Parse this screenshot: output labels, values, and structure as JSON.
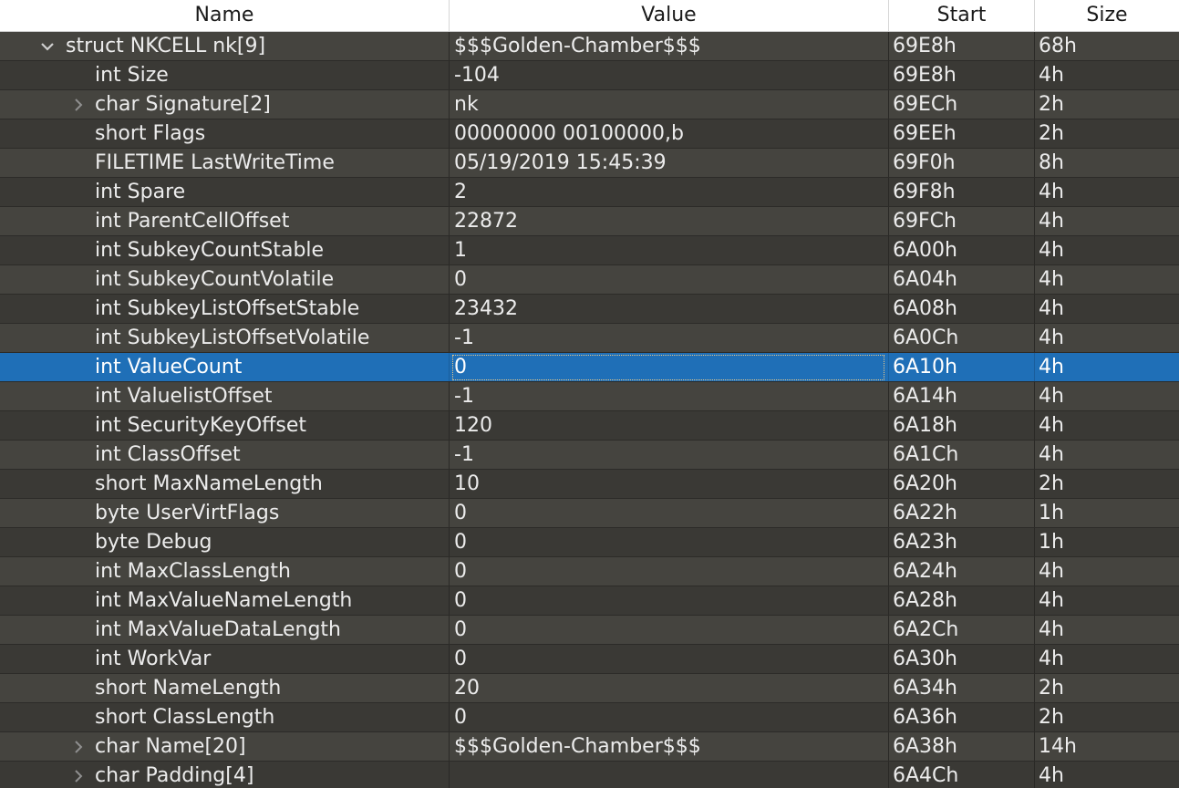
{
  "columns": {
    "name": "Name",
    "value": "Value",
    "start": "Start",
    "size": "Size"
  },
  "rows": [
    {
      "level": 0,
      "expander": "expanded",
      "name": "struct NKCELL nk[9]",
      "value": "$$$Golden-Chamber$$$",
      "start": "69E8h",
      "size": "68h"
    },
    {
      "level": 1,
      "expander": "none",
      "name": "int Size",
      "value": "-104",
      "start": "69E8h",
      "size": "4h"
    },
    {
      "level": 1,
      "expander": "collapsed",
      "name": "char Signature[2]",
      "value": "nk",
      "start": "69ECh",
      "size": "2h"
    },
    {
      "level": 1,
      "expander": "none",
      "name": "short Flags",
      "value": "00000000 00100000,b",
      "start": "69EEh",
      "size": "2h"
    },
    {
      "level": 1,
      "expander": "none",
      "name": "FILETIME LastWriteTime",
      "value": "05/19/2019 15:45:39",
      "start": "69F0h",
      "size": "8h"
    },
    {
      "level": 1,
      "expander": "none",
      "name": "int Spare",
      "value": "2",
      "start": "69F8h",
      "size": "4h"
    },
    {
      "level": 1,
      "expander": "none",
      "name": "int ParentCellOffset",
      "value": "22872",
      "start": "69FCh",
      "size": "4h"
    },
    {
      "level": 1,
      "expander": "none",
      "name": "int SubkeyCountStable",
      "value": "1",
      "start": "6A00h",
      "size": "4h"
    },
    {
      "level": 1,
      "expander": "none",
      "name": "int SubkeyCountVolatile",
      "value": "0",
      "start": "6A04h",
      "size": "4h"
    },
    {
      "level": 1,
      "expander": "none",
      "name": "int SubkeyListOffsetStable",
      "value": "23432",
      "start": "6A08h",
      "size": "4h"
    },
    {
      "level": 1,
      "expander": "none",
      "name": "int SubkeyListOffsetVolatile",
      "value": "-1",
      "start": "6A0Ch",
      "size": "4h"
    },
    {
      "level": 1,
      "expander": "none",
      "name": "int ValueCount",
      "value": "0",
      "start": "6A10h",
      "size": "4h",
      "selected": true
    },
    {
      "level": 1,
      "expander": "none",
      "name": "int ValuelistOffset",
      "value": "-1",
      "start": "6A14h",
      "size": "4h"
    },
    {
      "level": 1,
      "expander": "none",
      "name": "int SecurityKeyOffset",
      "value": "120",
      "start": "6A18h",
      "size": "4h"
    },
    {
      "level": 1,
      "expander": "none",
      "name": "int ClassOffset",
      "value": "-1",
      "start": "6A1Ch",
      "size": "4h"
    },
    {
      "level": 1,
      "expander": "none",
      "name": "short MaxNameLength",
      "value": "10",
      "start": "6A20h",
      "size": "2h"
    },
    {
      "level": 1,
      "expander": "none",
      "name": "byte UserVirtFlags",
      "value": "0",
      "start": "6A22h",
      "size": "1h"
    },
    {
      "level": 1,
      "expander": "none",
      "name": "byte Debug",
      "value": "0",
      "start": "6A23h",
      "size": "1h"
    },
    {
      "level": 1,
      "expander": "none",
      "name": "int MaxClassLength",
      "value": "0",
      "start": "6A24h",
      "size": "4h"
    },
    {
      "level": 1,
      "expander": "none",
      "name": "int MaxValueNameLength",
      "value": "0",
      "start": "6A28h",
      "size": "4h"
    },
    {
      "level": 1,
      "expander": "none",
      "name": "int MaxValueDataLength",
      "value": "0",
      "start": "6A2Ch",
      "size": "4h"
    },
    {
      "level": 1,
      "expander": "none",
      "name": "int WorkVar",
      "value": "0",
      "start": "6A30h",
      "size": "4h"
    },
    {
      "level": 1,
      "expander": "none",
      "name": "short NameLength",
      "value": "20",
      "start": "6A34h",
      "size": "2h"
    },
    {
      "level": 1,
      "expander": "none",
      "name": "short ClassLength",
      "value": "0",
      "start": "6A36h",
      "size": "2h"
    },
    {
      "level": 1,
      "expander": "collapsed",
      "name": "char Name[20]",
      "value": "$$$Golden-Chamber$$$",
      "start": "6A38h",
      "size": "14h"
    },
    {
      "level": 1,
      "expander": "collapsed",
      "name": "char Padding[4]",
      "value": "",
      "start": "6A4Ch",
      "size": "4h"
    }
  ],
  "icons": {
    "expanded": "chevron-down-icon",
    "collapsed": "chevron-right-icon"
  },
  "colors": {
    "header_bg": "#ffffff",
    "row_odd": "#45443f",
    "row_even": "#3a3935",
    "selected": "#1f6fb7",
    "text": "#ececec"
  }
}
